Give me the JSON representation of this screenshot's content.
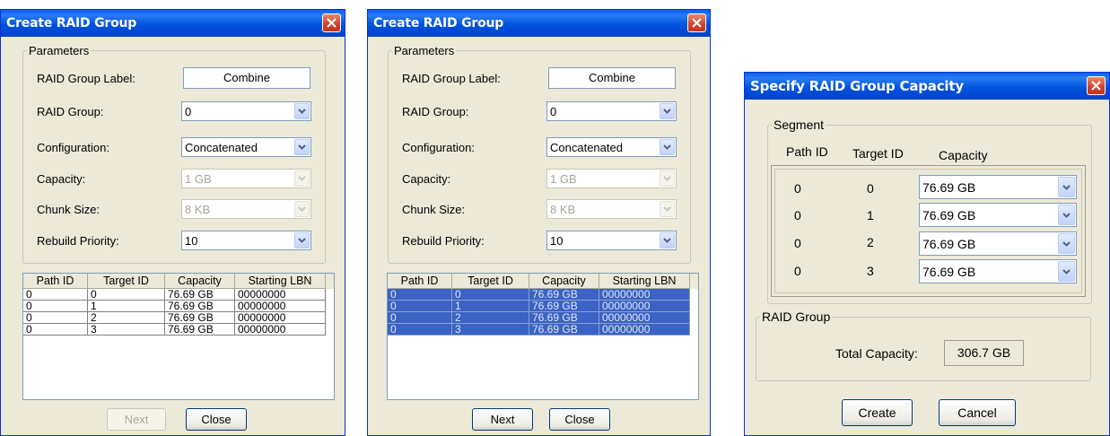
{
  "arrow_glyph": "chevron-down",
  "dialogs": [
    {
      "title": "Create RAID Group",
      "parameters_legend": "Parameters",
      "fields": [
        {
          "label": "RAID Group Label:",
          "value": "Combine",
          "kind": "text"
        },
        {
          "label": "RAID Group:",
          "value": "0",
          "kind": "combo"
        },
        {
          "label": "Configuration:",
          "value": "Concatenated",
          "kind": "combo"
        },
        {
          "label": "Capacity:",
          "value": "1 GB",
          "kind": "combo-disabled"
        },
        {
          "label": "Chunk Size:",
          "value": "8 KB",
          "kind": "combo-disabled"
        },
        {
          "label": "Rebuild Priority:",
          "value": "10",
          "kind": "combo"
        }
      ],
      "table": {
        "headers": [
          "Path ID",
          "Target ID",
          "Capacity",
          "Starting LBN"
        ],
        "rows": [
          [
            "0",
            "0",
            "76.69 GB",
            "00000000"
          ],
          [
            "0",
            "1",
            "76.69 GB",
            "00000000"
          ],
          [
            "0",
            "2",
            "76.69 GB",
            "00000000"
          ],
          [
            "0",
            "3",
            "76.69 GB",
            "00000000"
          ]
        ],
        "selected": false
      },
      "buttons": {
        "next": "Next",
        "close": "Close",
        "next_enabled": false
      }
    },
    {
      "title": "Create RAID Group",
      "parameters_legend": "Parameters",
      "fields": [
        {
          "label": "RAID Group Label:",
          "value": "Combine",
          "kind": "text"
        },
        {
          "label": "RAID Group:",
          "value": "0",
          "kind": "combo"
        },
        {
          "label": "Configuration:",
          "value": "Concatenated",
          "kind": "combo"
        },
        {
          "label": "Capacity:",
          "value": "1 GB",
          "kind": "combo-disabled"
        },
        {
          "label": "Chunk Size:",
          "value": "8 KB",
          "kind": "combo-disabled"
        },
        {
          "label": "Rebuild Priority:",
          "value": "10",
          "kind": "combo"
        }
      ],
      "table": {
        "headers": [
          "Path ID",
          "Target ID",
          "Capacity",
          "Starting LBN"
        ],
        "rows": [
          [
            "0",
            "0",
            "76.69 GB",
            "00000000"
          ],
          [
            "0",
            "1",
            "76.69 GB",
            "00000000"
          ],
          [
            "0",
            "2",
            "76.69 GB",
            "00000000"
          ],
          [
            "0",
            "3",
            "76.69 GB",
            "00000000"
          ]
        ],
        "selected": true
      },
      "buttons": {
        "next": "Next",
        "close": "Close",
        "next_enabled": true
      }
    }
  ],
  "capacity_dialog": {
    "title": "Specify RAID Group Capacity",
    "segment_legend": "Segment",
    "headers": [
      "Path ID",
      "Target ID",
      "Capacity"
    ],
    "rows": [
      {
        "path_id": "0",
        "target_id": "0",
        "capacity": "76.69 GB"
      },
      {
        "path_id": "0",
        "target_id": "1",
        "capacity": "76.69 GB"
      },
      {
        "path_id": "0",
        "target_id": "2",
        "capacity": "76.69 GB"
      },
      {
        "path_id": "0",
        "target_id": "3",
        "capacity": "76.69 GB"
      }
    ],
    "raid_group_legend": "RAID Group",
    "total_capacity_label": "Total Capacity:",
    "total_capacity_value": "306.7 GB",
    "create": "Create",
    "cancel": "Cancel"
  }
}
